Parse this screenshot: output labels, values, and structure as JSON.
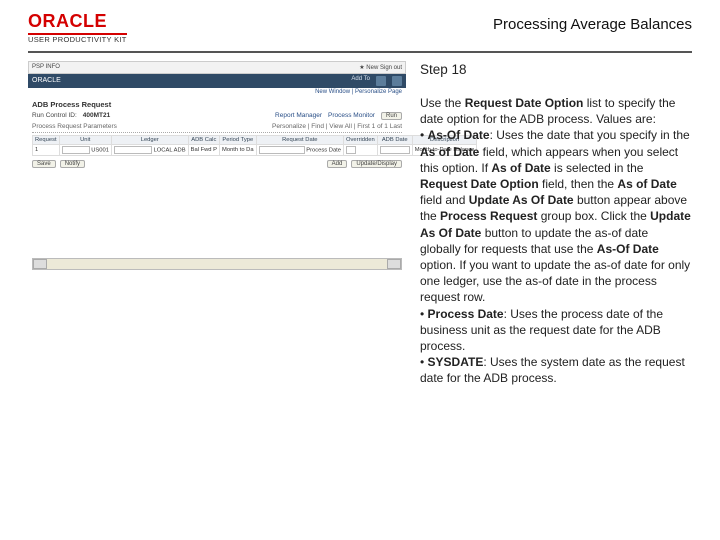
{
  "header": {
    "brand": "ORACLE",
    "brand_sub": "USER PRODUCTIVITY KIT",
    "title": "Processing Average Balances"
  },
  "step": {
    "label": "Step 18"
  },
  "instruction": {
    "p1_a": "Use the ",
    "p1_b": "Request Date Option",
    "p1_c": " list to specify the date option for the ADB process. Values are:",
    "b1_a": "• ",
    "b1_b": "As-Of Date",
    "b1_c": ": Uses the date that you specify in the ",
    "b1_d": "As of Date",
    "b1_e": " field, which appears when you select this option. If ",
    "b1_f": "As of Date",
    "b1_g": " is selected in the ",
    "b1_h": "Request Date Option",
    "b1_i": " field, then the ",
    "b1_j": "As of Date",
    "b1_k": " field and ",
    "b1_l": "Update As Of Date",
    "b1_m": " button appear above the ",
    "b1_n": "Process Request",
    "b1_o": " group box. Click the ",
    "b1_p": "Update As Of Date",
    "b1_q": " button to update the as-of date globally for requests that use the ",
    "b1_r": "As-Of Date",
    "b1_s": " option. If you want to update the as-of date for only one ledger, use the as-of date in the process request row.",
    "b2_a": "• ",
    "b2_b": "Process Date",
    "b2_c": ": Uses the process date of the business unit as the request date for the ADB process.",
    "b3_a": "• ",
    "b3_b": "SYSDATE",
    "b3_c": ": Uses the system date as the request date for the ADB process."
  },
  "shot": {
    "browser_left": "   PSP INFO   ",
    "browser_right": "★ New   Sign out",
    "bar_brand": "ORACLE",
    "bar_links": [
      "Add To",
      "",
      ""
    ],
    "sub_links": "New Window | Personalize Page",
    "page_title": "ADB Process Request",
    "run_label": "Run Control ID:",
    "run_value": "400MT21",
    "report_label": "Report Manager",
    "monitor_label": "Process Monitor",
    "run_btn": "Run",
    "group_title": "Process Request Parameters",
    "cols": [
      "Request",
      "Unit",
      "Ledger",
      "ADB Calc",
      "Period Type",
      "Request Date",
      "Overridden",
      "ADB Date",
      "Description"
    ],
    "row": {
      "request": "1",
      "unit": "US001",
      "ledger": "LOCAL ADB",
      "adb_calc": "Bal Fwd P",
      "period": "Month to Da",
      "reqdate": "Process Date",
      "adbdate": "",
      "desc": "Month-to-Date Balance"
    },
    "btn_save": "Save",
    "btn_notify": "Notify",
    "btn_add": "Add",
    "btn_update": "Update/Display",
    "group_find": "Personalize | Find | View All |",
    "group_count": "First 1 of 1 Last"
  }
}
